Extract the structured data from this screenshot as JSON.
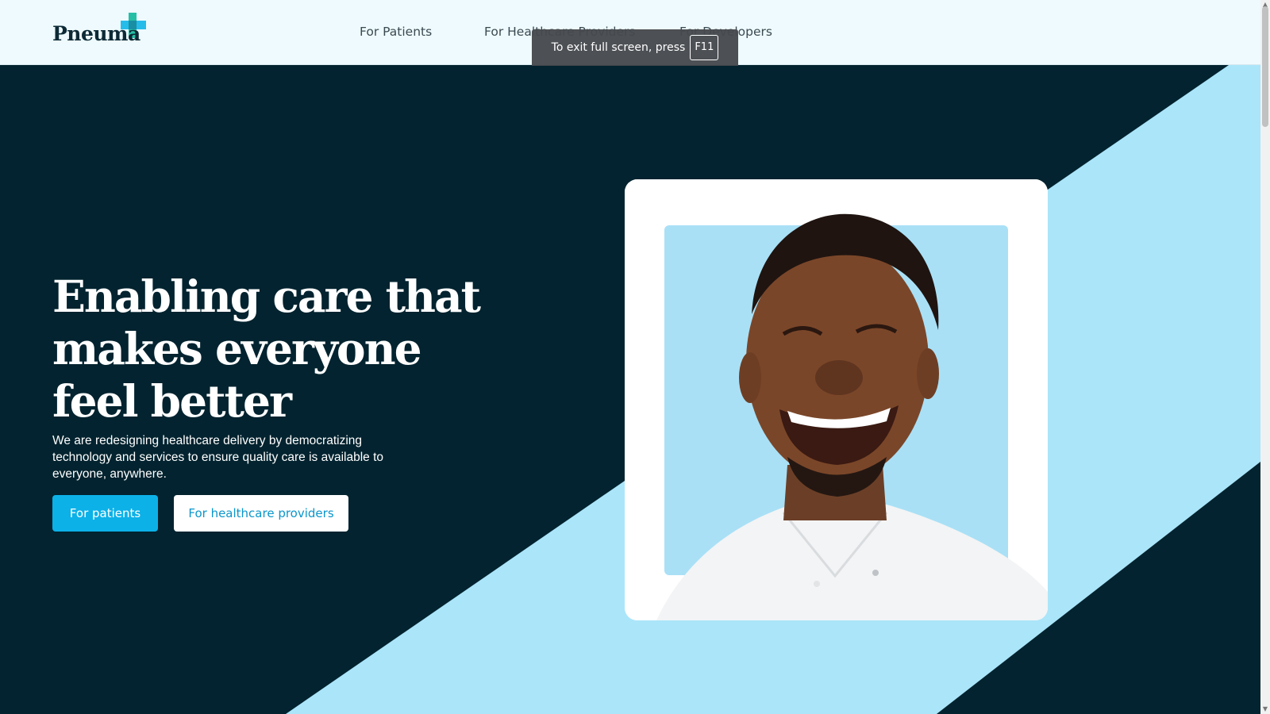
{
  "header": {
    "logo_text": "Pneuma",
    "nav": [
      "For Patients",
      "For Healthcare Providers",
      "For Developers"
    ]
  },
  "fullscreen_notice": {
    "text": "To exit full screen, press",
    "key": "F11"
  },
  "hero": {
    "headline": "Enabling care that makes everyone feel better",
    "subtext": "We are redesigning healthcare delivery by democratizing technology and services to ensure quality care is available to everyone, anywhere.",
    "primary_button": "For patients",
    "secondary_button": "For healthcare providers",
    "image": "smiling-man-photo"
  },
  "colors": {
    "background_dark": "#02232f",
    "accent_light_blue": "#abe5fa",
    "primary_button": "#0cb1e8",
    "logo_teal": "#25bfa5",
    "logo_cyan": "#0fb5e8"
  }
}
